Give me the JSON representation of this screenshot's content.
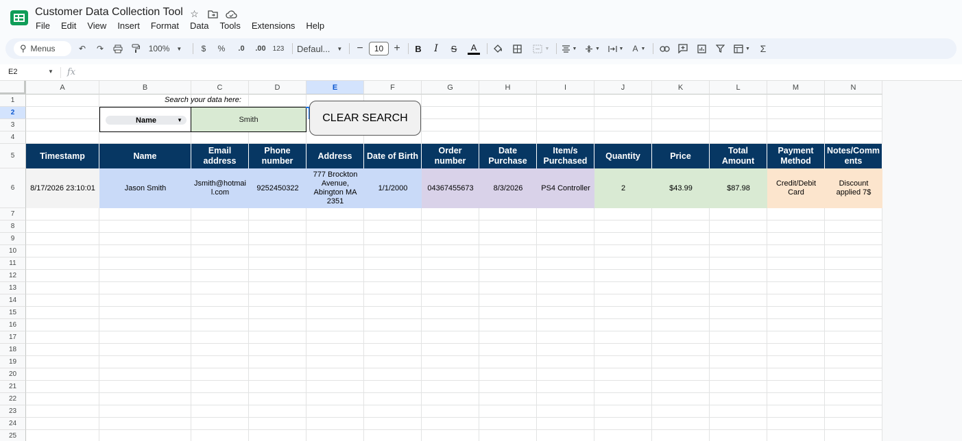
{
  "app": {
    "title": "Customer Data Collection Tool",
    "menus": [
      "File",
      "Edit",
      "View",
      "Insert",
      "Format",
      "Data",
      "Tools",
      "Extensions",
      "Help"
    ]
  },
  "toolbar": {
    "search_label": "Menus",
    "zoom": "100%",
    "currency": "$",
    "percent": "%",
    "dec_decrease": ".0",
    "dec_increase": ".00",
    "number_format": "123",
    "font": "Defaul...",
    "font_size": "10",
    "sigma": "Σ"
  },
  "formula_bar": {
    "cell_ref": "E2",
    "fx": "fx"
  },
  "columns": [
    "A",
    "B",
    "C",
    "D",
    "E",
    "F",
    "G",
    "H",
    "I",
    "J",
    "K",
    "L",
    "M",
    "N"
  ],
  "rows": [
    "1",
    "2",
    "3",
    "4",
    "5",
    "6",
    "7",
    "8",
    "9",
    "10",
    "11",
    "12",
    "13",
    "14",
    "15",
    "16",
    "17",
    "18",
    "19",
    "20",
    "21",
    "22",
    "23",
    "24",
    "25"
  ],
  "selected": {
    "column": "E",
    "row": "2"
  },
  "search": {
    "label": "Search your data here:",
    "field": "Name",
    "value": "Smith",
    "clear_button": "CLEAR SEARCH"
  },
  "table": {
    "headers": [
      "Timestamp",
      "Name",
      "Email address",
      "Phone number",
      "Address",
      "Date of Birth",
      "Order number",
      "Date Purchase",
      "Item/s Purchased",
      "Quantity",
      "Price",
      "Total Amount",
      "Payment Method",
      "Notes/Comm ents"
    ],
    "rows": [
      [
        "8/17/2026 23:10:01",
        "Jason Smith",
        "Jsmith@hotmai l.com",
        "9252450322",
        "777 Brockton Avenue, Abington MA 2351",
        "1/1/2000",
        "04367455673",
        "8/3/2026",
        "PS4 Controller",
        "2",
        "$43.99",
        "$87.98",
        "Credit/Debit Card",
        "Discount applied 7$"
      ]
    ]
  },
  "colors": {
    "header_bg": "#073763",
    "timestamp_bg": "#f3f3f3",
    "customer_bg": "#c9daf8",
    "order_bg": "#d9d2e9",
    "amount_bg": "#d9ead3",
    "payment_bg": "#fce5cd",
    "search_value_bg": "#d9ead3"
  }
}
